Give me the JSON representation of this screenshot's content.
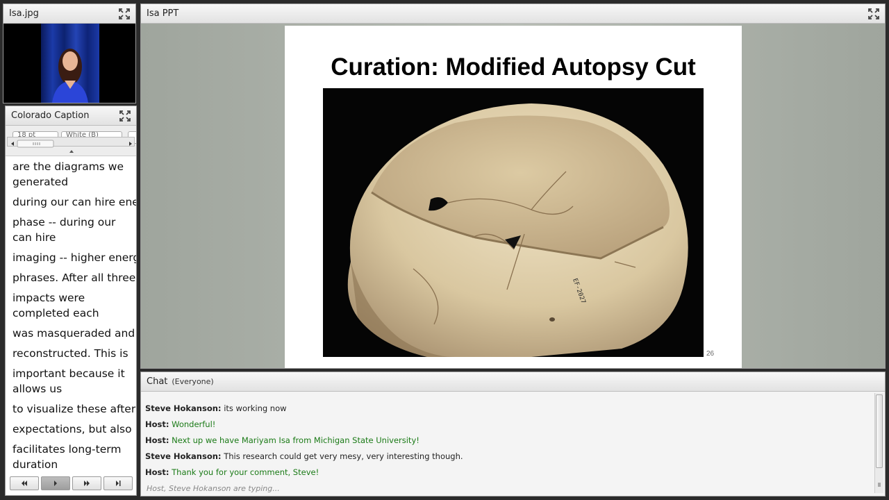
{
  "camera": {
    "title": "Isa.jpg"
  },
  "caption": {
    "title": "Colorado Caption",
    "font_size": "18 pt",
    "color": "White (B)",
    "lines": [
      {
        "text": "are the diagrams we generated",
        "wrap": true
      },
      {
        "text": "during our can hire ener",
        "wrap": false
      },
      {
        "text": "phase -- during our can hire",
        "wrap": true
      },
      {
        "text": "imaging -- higher energy",
        "wrap": false
      },
      {
        "text": "phrases. After all three",
        "wrap": false
      },
      {
        "text": "impacts were completed each",
        "wrap": true
      },
      {
        "text": "was masqueraded and",
        "wrap": false
      },
      {
        "text": "reconstructed. This is",
        "wrap": false
      },
      {
        "text": "important because it allows us",
        "wrap": true
      },
      {
        "text": "to visualize these after",
        "wrap": false
      },
      {
        "text": "expectations, but also",
        "wrap": false
      },
      {
        "text": "facilitates long-term duration",
        "wrap": true
      }
    ]
  },
  "slide": {
    "pod_title": "Isa PPT",
    "title": "Curation: Modified Autopsy Cut",
    "page_number": "26",
    "specimen_label": "EF-2027"
  },
  "chat": {
    "title": "Chat",
    "scope": "(Everyone)",
    "messages": [
      {
        "sender": "Steve Hokanson:",
        "text": "its working now",
        "host": false
      },
      {
        "sender": "Host:",
        "text": "Wonderful!",
        "host": true
      },
      {
        "sender": "Host:",
        "text": "Next up we have Mariyam Isa from Michigan State University!",
        "host": true
      },
      {
        "sender": "Steve Hokanson:",
        "text": "This research could get very mesy, very interesting though.",
        "host": false
      },
      {
        "sender": "Host:",
        "text": "Thank you for your comment, Steve!",
        "host": true
      }
    ],
    "typing": "Host, Steve Hokanson are typing..."
  },
  "colors": {
    "host_text": "#1a7a16",
    "chrome": "#e2e2e2"
  }
}
